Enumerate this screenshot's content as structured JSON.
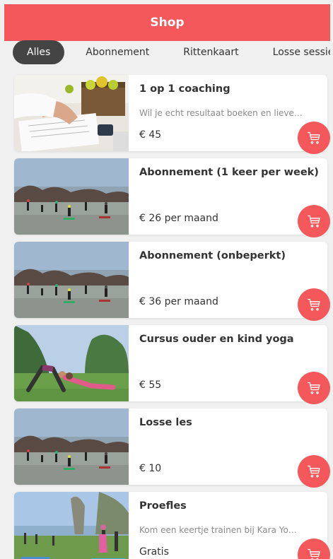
{
  "header": {
    "title": "Shop"
  },
  "tabs": [
    {
      "label": "Alles",
      "active": true
    },
    {
      "label": "Abonnement",
      "active": false
    },
    {
      "label": "Rittenkaart",
      "active": false
    },
    {
      "label": "Losse sessie",
      "active": false
    }
  ],
  "products": [
    {
      "title": "1 op 1 coaching",
      "description": "Wil je echt resultaat boeken en lieve…",
      "price": "€ 45",
      "image": "coaching-photo"
    },
    {
      "title": "Abonnement (1 keer per week)",
      "description": "",
      "price": "€ 26 per maand",
      "image": "outdoor-yoga-group-photo"
    },
    {
      "title": "Abonnement (onbeperkt)",
      "description": "",
      "price": "€ 36 per maand",
      "image": "outdoor-yoga-group-photo"
    },
    {
      "title": "Cursus ouder en kind yoga",
      "description": "",
      "price": "€ 55",
      "image": "parent-child-yoga-photo"
    },
    {
      "title": "Losse les",
      "description": "",
      "price": "€ 10",
      "image": "outdoor-yoga-group-photo"
    },
    {
      "title": "Proefles",
      "description": "Kom een keertje trainen bij Kara Yo…",
      "price": "Gratis",
      "image": "lakeside-yoga-photo"
    }
  ],
  "icons": {
    "cart": "shopping-cart-icon"
  },
  "colors": {
    "accent": "#f5585a",
    "active_tab": "#444444",
    "background": "#f0f0f0"
  }
}
